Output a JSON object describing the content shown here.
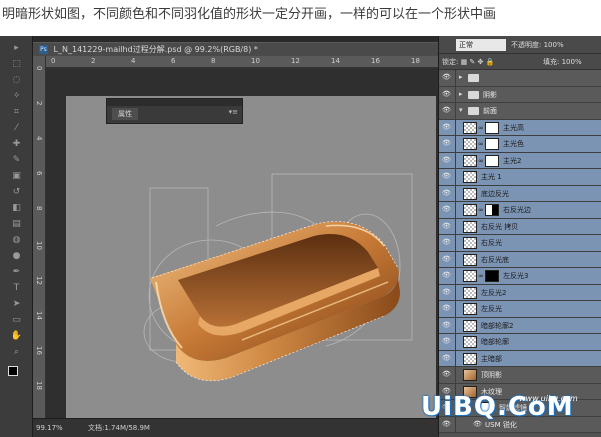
{
  "caption": "明暗形状如图，不同颜色和不同羽化值的形状一定分开画，一样的可以在一个形状中画",
  "document": {
    "tab_title": "L_N_141229-mailhd过程分解.psd @ 99.2%(RGB/8) *",
    "ps_badge": "Ps"
  },
  "ruler_top": [
    "0",
    "2",
    "4",
    "6",
    "8",
    "10",
    "12",
    "14",
    "16",
    "18"
  ],
  "ruler_left": [
    "0",
    "2",
    "4",
    "6",
    "8",
    "10",
    "12",
    "14",
    "16",
    "18"
  ],
  "properties_panel": {
    "tab_label": "属性",
    "menu_glyph": "▾≡"
  },
  "status_bar": {
    "zoom": "99.17%",
    "doc_info": "文档:1.74M/58.9M"
  },
  "layers_panel": {
    "blend_mode": "正常",
    "opacity_label": "不透明度:",
    "opacity_value": "100%",
    "lock_label": "锁定:",
    "fill_label": "填充:",
    "fill_value": "100%",
    "layers": [
      {
        "name": "",
        "type": "group-header",
        "selected": false
      },
      {
        "name": "阴影",
        "type": "group",
        "selected": false
      },
      {
        "name": "前面",
        "type": "group-open",
        "selected": false
      },
      {
        "name": "主光高",
        "type": "masked",
        "mask": "white",
        "selected": true
      },
      {
        "name": "主光色",
        "type": "masked",
        "mask": "white",
        "selected": true
      },
      {
        "name": "主光2",
        "type": "masked",
        "mask": "white",
        "selected": true
      },
      {
        "name": "主光 1",
        "type": "shape",
        "selected": true
      },
      {
        "name": "底边反光",
        "type": "shape",
        "selected": true
      },
      {
        "name": "右反光边",
        "type": "masked",
        "mask": "half",
        "selected": true
      },
      {
        "name": "右反光 拷贝",
        "type": "shape",
        "selected": true
      },
      {
        "name": "右反光",
        "type": "shape",
        "selected": true
      },
      {
        "name": "右反光底",
        "type": "shape",
        "selected": true
      },
      {
        "name": "左反光3",
        "type": "masked",
        "mask": "black",
        "selected": true
      },
      {
        "name": "左反光2",
        "type": "shape",
        "selected": true
      },
      {
        "name": "左反光",
        "type": "shape",
        "selected": true
      },
      {
        "name": "暗部轮廓2",
        "type": "shape",
        "selected": true
      },
      {
        "name": "暗部轮廓",
        "type": "shape",
        "selected": true
      },
      {
        "name": "主暗部",
        "type": "shape",
        "selected": true
      },
      {
        "name": "顶阴影",
        "type": "pixel",
        "selected": false
      },
      {
        "name": "木纹理",
        "type": "smart",
        "selected": false
      },
      {
        "name": "智能滤镜",
        "type": "filter",
        "selected": false
      },
      {
        "name": "USM 锐化",
        "type": "filter-item",
        "selected": false
      }
    ]
  },
  "watermark": {
    "big": "UiBQ.CoM",
    "small": "www.uibq.com"
  },
  "colors": {
    "selected_layer": "#7c94b4",
    "canvas": "#8d8d8d",
    "tray_wood": "#c97f3a"
  }
}
